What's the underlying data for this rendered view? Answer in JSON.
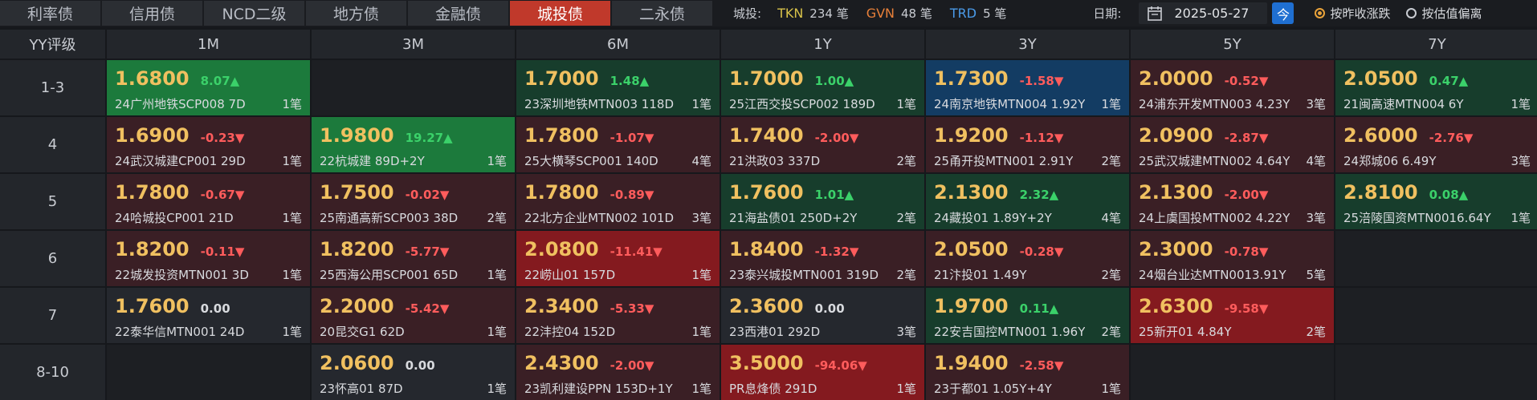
{
  "tabs": [
    {
      "label": "利率债",
      "active": false
    },
    {
      "label": "信用债",
      "active": false
    },
    {
      "label": "NCD二级",
      "active": false
    },
    {
      "label": "地方债",
      "active": false
    },
    {
      "label": "金融债",
      "active": false
    },
    {
      "label": "城投债",
      "active": true
    },
    {
      "label": "二永债",
      "active": false
    }
  ],
  "stats": {
    "label": "城投:",
    "tkn_label": "TKN",
    "tkn_value": "234 笔",
    "gvn_label": "GVN",
    "gvn_value": "48 笔",
    "trd_label": "TRD",
    "trd_value": "5 笔"
  },
  "date": {
    "label": "日期:",
    "value": "2025-05-27",
    "today_label": "今",
    "icon": "calendar-icon"
  },
  "radios": [
    {
      "label": "按昨收涨跌",
      "selected": true
    },
    {
      "label": "按估值偏离",
      "selected": false
    }
  ],
  "table": {
    "corner": "YY评级",
    "columns": [
      "1M",
      "3M",
      "6M",
      "1Y",
      "3Y",
      "5Y",
      "7Y"
    ],
    "rows": [
      {
        "label": "1-3",
        "cells": [
          {
            "price": "1.6800",
            "change": "8.07▲",
            "dir": "up",
            "bond": "24广州地铁SCP008 7D",
            "count": "1笔",
            "style": "c-up-strong"
          },
          null,
          {
            "price": "1.7000",
            "change": "1.48▲",
            "dir": "up",
            "bond": "23深圳地铁MTN003 118D",
            "count": "1笔",
            "style": "c-up"
          },
          {
            "price": "1.7000",
            "change": "1.00▲",
            "dir": "up",
            "bond": "25江西交投SCP002 189D",
            "count": "1笔",
            "style": "c-up"
          },
          {
            "price": "1.7300",
            "change": "-1.58▼",
            "dir": "down",
            "bond": "24南京地铁MTN004 1.92Y",
            "count": "1笔",
            "style": "c-blue"
          },
          {
            "price": "2.0000",
            "change": "-0.52▼",
            "dir": "down",
            "bond": "24浦东开发MTN003 4.23Y",
            "count": "3笔",
            "style": "c-down"
          },
          {
            "price": "2.0500",
            "change": "0.47▲",
            "dir": "up",
            "bond": "21闽高速MTN004 6Y",
            "count": "1笔",
            "style": "c-up"
          }
        ]
      },
      {
        "label": "4",
        "cells": [
          {
            "price": "1.6900",
            "change": "-0.23▼",
            "dir": "down",
            "bond": "24武汉城建CP001 29D",
            "count": "1笔",
            "style": "c-down"
          },
          {
            "price": "1.9800",
            "change": "19.27▲",
            "dir": "up",
            "bond": "22杭城建 89D+2Y",
            "count": "1笔",
            "style": "c-up-strong"
          },
          {
            "price": "1.7800",
            "change": "-1.07▼",
            "dir": "down",
            "bond": "25大横琴SCP001 140D",
            "count": "4笔",
            "style": "c-down"
          },
          {
            "price": "1.7400",
            "change": "-2.00▼",
            "dir": "down",
            "bond": "21洪政03 337D",
            "count": "2笔",
            "style": "c-down"
          },
          {
            "price": "1.9200",
            "change": "-1.12▼",
            "dir": "down",
            "bond": "25甬开投MTN001 2.91Y",
            "count": "2笔",
            "style": "c-down"
          },
          {
            "price": "2.0900",
            "change": "-2.87▼",
            "dir": "down",
            "bond": "25武汉城建MTN002 4.64Y",
            "count": "4笔",
            "style": "c-down"
          },
          {
            "price": "2.6000",
            "change": "-2.76▼",
            "dir": "down",
            "bond": "24郑城06 6.49Y",
            "count": "3笔",
            "style": "c-down"
          }
        ]
      },
      {
        "label": "5",
        "cells": [
          {
            "price": "1.7800",
            "change": "-0.67▼",
            "dir": "down",
            "bond": "24哈城投CP001 21D",
            "count": "1笔",
            "style": "c-down"
          },
          {
            "price": "1.7500",
            "change": "-0.02▼",
            "dir": "down",
            "bond": "25南通高新SCP003 38D",
            "count": "2笔",
            "style": "c-down"
          },
          {
            "price": "1.7800",
            "change": "-0.89▼",
            "dir": "down",
            "bond": "22北方企业MTN002 101D",
            "count": "3笔",
            "style": "c-down"
          },
          {
            "price": "1.7600",
            "change": "1.01▲",
            "dir": "up",
            "bond": "21海盐债01 250D+2Y",
            "count": "2笔",
            "style": "c-up"
          },
          {
            "price": "2.1300",
            "change": "2.32▲",
            "dir": "up",
            "bond": "24藏投01 1.89Y+2Y",
            "count": "4笔",
            "style": "c-up"
          },
          {
            "price": "2.1300",
            "change": "-2.00▼",
            "dir": "down",
            "bond": "24上虞国投MTN002 4.22Y",
            "count": "3笔",
            "style": "c-down"
          },
          {
            "price": "2.8100",
            "change": "0.08▲",
            "dir": "up",
            "bond": "25涪陵国资MTN0016.64Y",
            "count": "1笔",
            "style": "c-up"
          }
        ]
      },
      {
        "label": "6",
        "cells": [
          {
            "price": "1.8200",
            "change": "-0.11▼",
            "dir": "down",
            "bond": "22城发投资MTN001 3D",
            "count": "1笔",
            "style": "c-down"
          },
          {
            "price": "1.8200",
            "change": "-5.77▼",
            "dir": "down",
            "bond": "25西海公用SCP001 65D",
            "count": "1笔",
            "style": "c-down"
          },
          {
            "price": "2.0800",
            "change": "-11.41▼",
            "dir": "down",
            "bond": "22崂山01 157D",
            "count": "1笔",
            "style": "c-down-strong"
          },
          {
            "price": "1.8400",
            "change": "-1.32▼",
            "dir": "down",
            "bond": "23泰兴城投MTN001 319D",
            "count": "2笔",
            "style": "c-down"
          },
          {
            "price": "2.0500",
            "change": "-0.28▼",
            "dir": "down",
            "bond": "21汴投01 1.49Y",
            "count": "2笔",
            "style": "c-down"
          },
          {
            "price": "2.3000",
            "change": "-0.78▼",
            "dir": "down",
            "bond": "24烟台业达MTN0013.91Y",
            "count": "5笔",
            "style": "c-down"
          },
          null
        ]
      },
      {
        "label": "7",
        "cells": [
          {
            "price": "1.7600",
            "change": "0.00",
            "dir": "flat",
            "bond": "22泰华信MTN001 24D",
            "count": "1笔",
            "style": "c-flat"
          },
          {
            "price": "2.2000",
            "change": "-5.42▼",
            "dir": "down",
            "bond": "20昆交G1 62D",
            "count": "1笔",
            "style": "c-down"
          },
          {
            "price": "2.3400",
            "change": "-5.33▼",
            "dir": "down",
            "bond": "22沣控04 152D",
            "count": "1笔",
            "style": "c-down"
          },
          {
            "price": "2.3600",
            "change": "0.00",
            "dir": "flat",
            "bond": "23西港01 292D",
            "count": "3笔",
            "style": "c-flat"
          },
          {
            "price": "1.9700",
            "change": "0.11▲",
            "dir": "up",
            "bond": "22安吉国控MTN001 1.96Y",
            "count": "2笔",
            "style": "c-up"
          },
          {
            "price": "2.6300",
            "change": "-9.58▼",
            "dir": "down",
            "bond": "25新开01 4.84Y",
            "count": "2笔",
            "style": "c-down-strong"
          },
          null
        ]
      },
      {
        "label": "8-10",
        "cells": [
          null,
          {
            "price": "2.0600",
            "change": "0.00",
            "dir": "flat",
            "bond": "23怀高01 87D",
            "count": "1笔",
            "style": "c-flat"
          },
          {
            "price": "2.4300",
            "change": "-2.00▼",
            "dir": "down",
            "bond": "23凯利建设PPN 153D+1Y",
            "count": "1笔",
            "style": "c-down"
          },
          {
            "price": "3.5000",
            "change": "-94.06▼",
            "dir": "down",
            "bond": "PR息烽债 291D",
            "count": "1笔",
            "style": "c-down-strong"
          },
          {
            "price": "1.9400",
            "change": "-2.58▼",
            "dir": "down",
            "bond": "23于都01 1.05Y+4Y",
            "count": "1笔",
            "style": "c-down"
          },
          null,
          null
        ]
      }
    ]
  }
}
